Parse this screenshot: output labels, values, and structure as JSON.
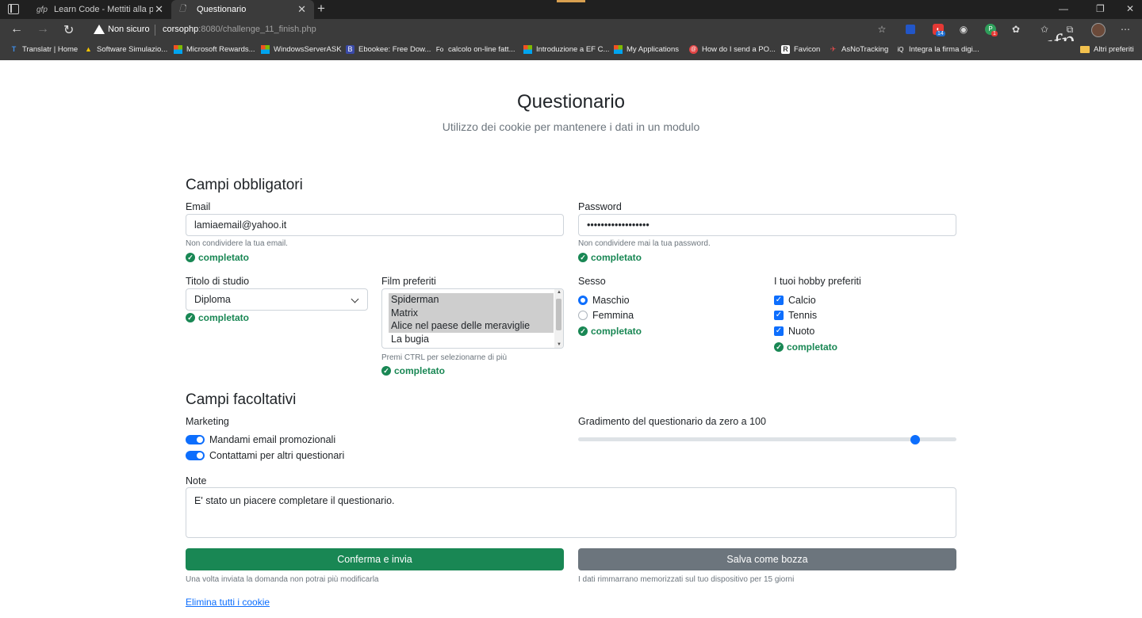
{
  "browser": {
    "tabs": [
      {
        "title": "Learn Code - Mettiti alla prova: u",
        "favicon": "gfp-icon"
      },
      {
        "title": "Questionario",
        "favicon": "page-icon"
      }
    ],
    "security_label": "Non sicuro",
    "url_host": "corsophp",
    "url_rest": ":8080/challenge_11_finish.php",
    "extension_badge": "14",
    "extension_badge2": "1",
    "brand_mark": "gfp",
    "bookmarks": [
      {
        "label": "Translatr | Home",
        "icon": "T"
      },
      {
        "label": "Software Simulazio...",
        "icon": "▲"
      },
      {
        "label": "Microsoft Rewards...",
        "icon": "ms"
      },
      {
        "label": "WindowsServerASK",
        "icon": "ms"
      },
      {
        "label": "Ebookee: Free Dow...",
        "icon": "B"
      },
      {
        "label": "calcolo on-line fatt...",
        "icon": "Fo"
      },
      {
        "label": "Introduzione a EF C...",
        "icon": "ms"
      },
      {
        "label": "My Applications",
        "icon": "ms"
      },
      {
        "label": "How do I send a PO...",
        "icon": "@"
      },
      {
        "label": "Favicon",
        "icon": "R"
      },
      {
        "label": "AsNoTracking",
        "icon": "✈"
      },
      {
        "label": "Integra la firma digi...",
        "icon": "iQ"
      }
    ],
    "other_favorites": "Altri preferiti"
  },
  "form": {
    "title": "Questionario",
    "subtitle": "Utilizzo dei cookie per mantenere i dati in un modulo",
    "required_section": "Campi obbligatori",
    "email": {
      "label": "Email",
      "value": "lamiaemail@yahoo.it",
      "help": "Non condividere la tua email.",
      "status": "completato"
    },
    "password": {
      "label": "Password",
      "value": "••••••••••••••••••",
      "help": "Non condividere mai la tua password.",
      "status": "completato"
    },
    "degree": {
      "label": "Titolo di studio",
      "value": "Diploma",
      "status": "completato"
    },
    "movies": {
      "label": "Film preferiti",
      "options": [
        {
          "text": "Spiderman",
          "selected": true
        },
        {
          "text": "Matrix",
          "selected": true
        },
        {
          "text": "Alice nel paese delle meraviglie",
          "selected": true
        },
        {
          "text": "La bugia",
          "selected": false
        }
      ],
      "help": "Premi CTRL per selezionarne di più",
      "status": "completato"
    },
    "sex": {
      "label": "Sesso",
      "options": [
        {
          "text": "Maschio",
          "checked": true
        },
        {
          "text": "Femmina",
          "checked": false
        }
      ],
      "status": "completato"
    },
    "hobbies": {
      "label": "I tuoi hobby preferiti",
      "options": [
        {
          "text": "Calcio",
          "checked": true
        },
        {
          "text": "Tennis",
          "checked": true
        },
        {
          "text": "Nuoto",
          "checked": true
        }
      ],
      "status": "completato"
    },
    "optional_section": "Campi facoltativi",
    "marketing": {
      "label": "Marketing",
      "switches": [
        {
          "text": "Mandami email promozionali",
          "on": true
        },
        {
          "text": "Contattami per altri questionari",
          "on": true
        }
      ]
    },
    "rating": {
      "label": "Gradimento del questionario da zero a 100",
      "value": 90,
      "min": 0,
      "max": 100
    },
    "notes": {
      "label": "Note",
      "value": "E' stato un piacere completare il questionario."
    },
    "submit": {
      "label": "Conferma e invia",
      "help": "Una volta inviata la domanda non potrai più modificarla"
    },
    "draft": {
      "label": "Salva come bozza",
      "help": "I dati rimmarrano memorizzati sul tuo dispositivo per 15 giorni"
    },
    "clear_cookies": "Elimina tutti i cookie"
  }
}
